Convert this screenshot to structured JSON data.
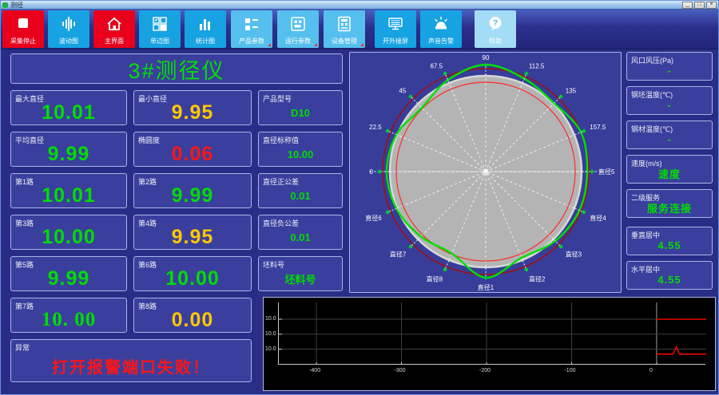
{
  "window": {
    "title": "测径",
    "minimize": "_",
    "maximize": "□",
    "close": "×"
  },
  "toolbar": {
    "buttons": [
      {
        "label": "采集停止",
        "style": "red",
        "icon": "stop-icon"
      },
      {
        "label": "波动图",
        "style": "blue",
        "icon": "waveform-icon"
      },
      {
        "label": "主界面",
        "style": "red",
        "icon": "home-icon"
      },
      {
        "label": "单边图",
        "style": "blue",
        "icon": "panels-icon"
      },
      {
        "label": "统计图",
        "style": "blue",
        "icon": "bar-chart-icon"
      },
      {
        "label": "产品参数",
        "style": "light",
        "icon": "product-params-icon",
        "corner": true
      },
      {
        "label": "运行参数",
        "style": "light",
        "icon": "run-params-icon",
        "corner": true
      },
      {
        "label": "设备管理",
        "style": "light",
        "icon": "device-icon",
        "corner": true
      },
      {
        "label": "开外接屏",
        "style": "blue",
        "icon": "monitor-icon"
      },
      {
        "label": "声音告警",
        "style": "blue",
        "icon": "alarm-icon"
      },
      {
        "label": "帮助",
        "style": "lighter",
        "icon": "help-icon"
      }
    ]
  },
  "left_panel": {
    "title": "3#测径仪",
    "cells": [
      {
        "label": "最大直径",
        "value": "10.01",
        "color": "green",
        "size": "big"
      },
      {
        "label": "最小直径",
        "value": "9.95",
        "color": "yellow",
        "size": "big"
      },
      {
        "label": "产品型号",
        "value": "D10",
        "color": "green",
        "size": "small"
      },
      {
        "label": "平均直径",
        "value": "9.99",
        "color": "green",
        "size": "big"
      },
      {
        "label": "椭圆度",
        "value": "0.06",
        "color": "red",
        "size": "big"
      },
      {
        "label": "直径标称值",
        "value": "10.00",
        "color": "green",
        "size": "small"
      },
      {
        "label": "第1路",
        "value": "10.01",
        "color": "green",
        "size": "big"
      },
      {
        "label": "第2路",
        "value": "9.99",
        "color": "green",
        "size": "big"
      },
      {
        "label": "直径正公差",
        "value": "0.01",
        "color": "green",
        "size": "small"
      },
      {
        "label": "第3路",
        "value": "10.00",
        "color": "green",
        "size": "big"
      },
      {
        "label": "第4路",
        "value": "9.95",
        "color": "yellow",
        "size": "big"
      },
      {
        "label": "直径负公差",
        "value": "0.01",
        "color": "green",
        "size": "small"
      },
      {
        "label": "第5路",
        "value": "9.99",
        "color": "green",
        "size": "big"
      },
      {
        "label": "第6路",
        "value": "10.00",
        "color": "green",
        "size": "big"
      },
      {
        "label": "坯料号",
        "value": "坯料号",
        "color": "green",
        "size": "small"
      },
      {
        "label": "第7路",
        "value": "10. 00",
        "color": "green",
        "size": "big",
        "serif": true
      },
      {
        "label": "第8路",
        "value": "0.00",
        "color": "yellow",
        "size": "big"
      }
    ],
    "alarm": {
      "label": "异常",
      "message": "打开报警端口失败！"
    }
  },
  "right_panel": {
    "items": [
      {
        "label": "风口风压(Pa)",
        "value": "-"
      },
      {
        "label": "钢坯温度(℃)",
        "value": "-"
      },
      {
        "label": "钢材温度(℃)",
        "value": "-"
      },
      {
        "label": "速度(m/s)",
        "value": "速度"
      },
      {
        "label": "二级服务",
        "value": "服务连接"
      },
      {
        "label": "垂直居中",
        "value": "4.55"
      },
      {
        "label": "水平居中",
        "value": "4.55"
      }
    ]
  },
  "polar": {
    "type": "polar-profile",
    "labels": [
      {
        "text": "90",
        "angle": 90
      },
      {
        "text": "112.5",
        "angle": 67.5
      },
      {
        "text": "135",
        "angle": 45
      },
      {
        "text": "157.5",
        "angle": 22.5
      },
      {
        "text": "直径5",
        "angle": 0
      },
      {
        "text": "直径4",
        "angle": -22.5
      },
      {
        "text": "直径3",
        "angle": -45
      },
      {
        "text": "直径2",
        "angle": -67.5
      },
      {
        "text": "直径1",
        "angle": -90
      },
      {
        "text": "直径8",
        "angle": -112.5
      },
      {
        "text": "直径7",
        "angle": -135
      },
      {
        "text": "直径6",
        "angle": -157.5
      },
      {
        "text": "0",
        "angle": 180
      },
      {
        "text": "22.5",
        "angle": 157.5
      },
      {
        "text": "45",
        "angle": 135
      },
      {
        "text": "67.5",
        "angle": 112.5
      }
    ],
    "curve_radii": [
      127,
      129,
      121,
      126,
      134,
      124,
      113,
      121,
      124,
      121,
      115,
      111,
      133,
      117,
      123,
      127
    ],
    "disk_radius": 120,
    "outer_circle_radius": 129,
    "inner_circle_radius": 112,
    "colors": {
      "disk": "#b4b4b4",
      "rim": "#d8d8d8",
      "outer_circle": "#a01010",
      "inner_circle": "#ff2a2a",
      "curve": "#00e000",
      "grid": "#ffffff"
    }
  },
  "trend": {
    "type": "line",
    "x_ticks": [
      {
        "label": "-400",
        "pos": 8.8
      },
      {
        "label": "-300",
        "pos": 28.7
      },
      {
        "label": "-200",
        "pos": 48.6
      },
      {
        "label": "-100",
        "pos": 68.5
      },
      {
        "label": "0",
        "pos": 88.4
      }
    ],
    "y_ticks": [
      {
        "label": "10.0",
        "pos": 27
      },
      {
        "label": "10.0",
        "pos": 51
      },
      {
        "label": "10.0",
        "pos": 75
      }
    ],
    "red_segments": [
      {
        "y": 27,
        "x1": 88.4,
        "x2": 100
      },
      {
        "y": 83,
        "x1": 88.4,
        "x2": 100,
        "spike_x": 93,
        "spike_y": 71
      }
    ],
    "series_color": "#ff0000"
  }
}
